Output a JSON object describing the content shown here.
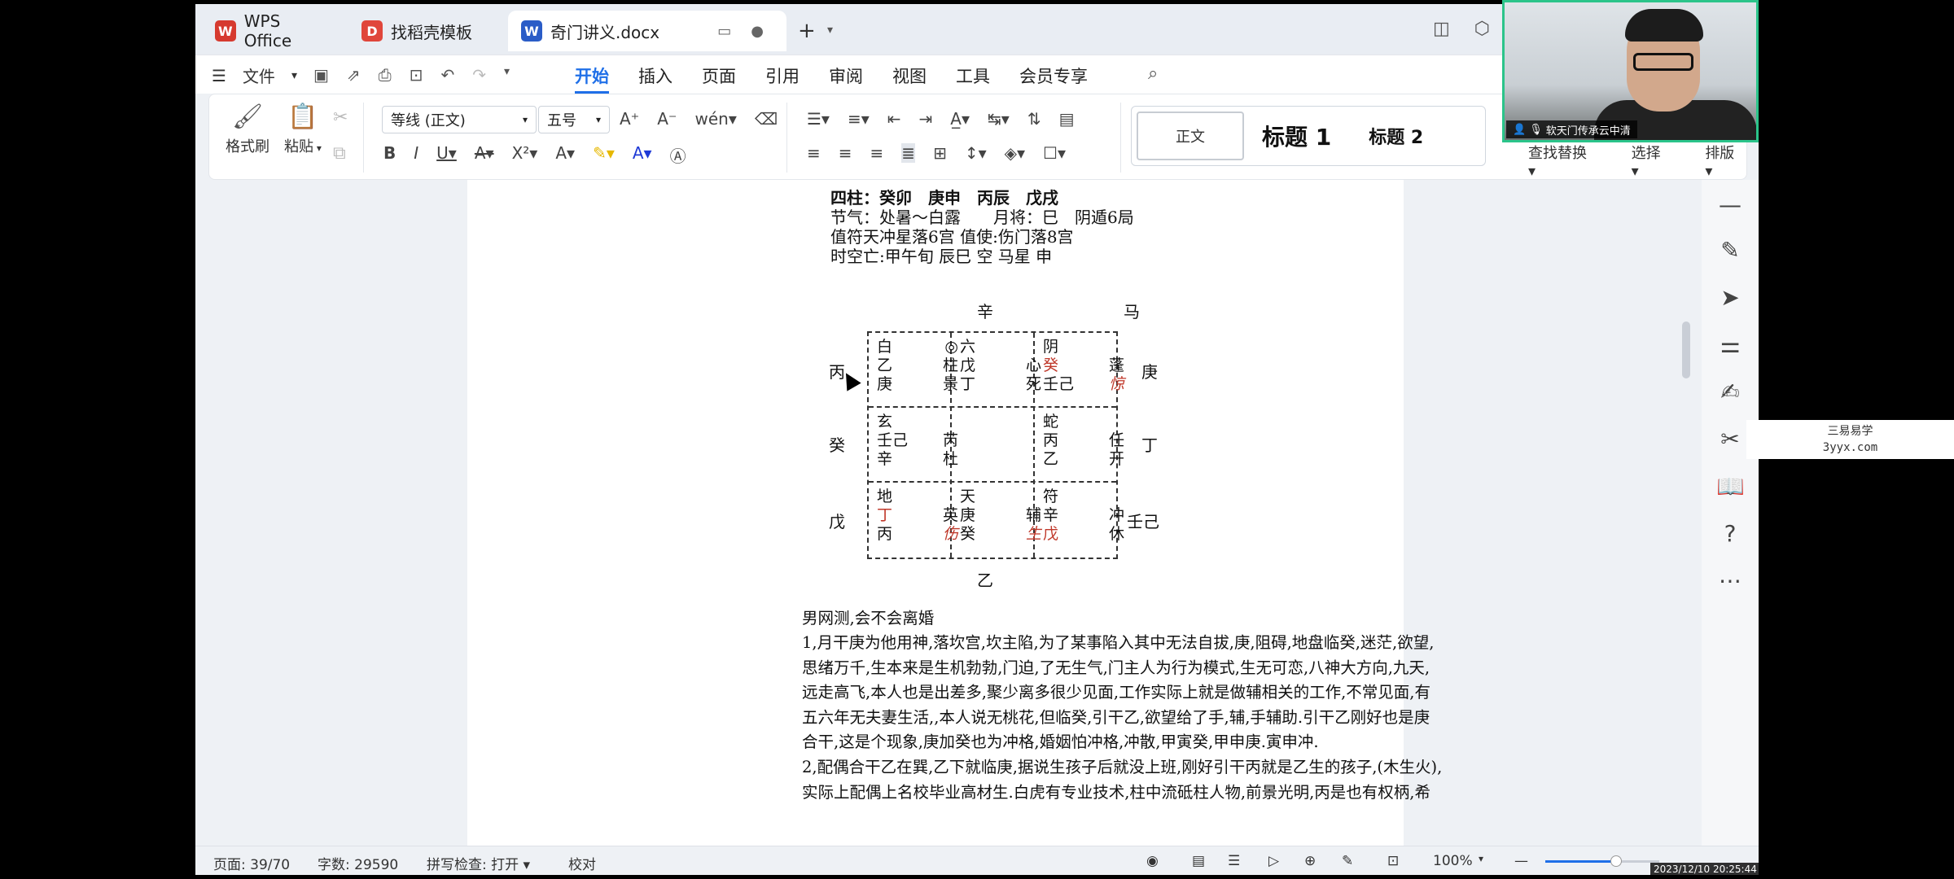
{
  "tabs": [
    {
      "label": "WPS Office",
      "icon": "wps-logo-icon",
      "color": "#d63a2f"
    },
    {
      "label": "找稻壳模板",
      "icon": "docer-icon",
      "color": "#e0463b"
    },
    {
      "label": "奇门讲义.docx",
      "icon": "word-doc-icon",
      "color": "#2a5cc7"
    }
  ],
  "menu": {
    "file": "文件",
    "tabs": [
      "开始",
      "插入",
      "页面",
      "引用",
      "审阅",
      "视图",
      "工具",
      "会员专享"
    ],
    "active_tab": "开始"
  },
  "ribbon": {
    "format_painter": "格式刷",
    "paste": "粘贴",
    "font_name": "等线 (正文)",
    "font_size": "五号",
    "styles": {
      "normal": "正文",
      "h1": "标题 1",
      "h2": "标题 2"
    },
    "find_replace": "查找替换",
    "select": "选择",
    "sort": "排版"
  },
  "doc": {
    "header_lines": [
      "四柱：癸卯　庚申　丙辰　戊戌",
      "节气：处暑～白露　　月将：巳　阴遁6局",
      "值符天冲星落6宫 值使:伤门落8宫",
      "时空亡:甲午旬 辰巳 空 马星 申"
    ],
    "grid_top": "辛",
    "grid_top_right": "马",
    "grid_bottom": "乙",
    "left_labels": [
      "丙",
      "癸",
      "戊"
    ],
    "right_labels": [
      "庚",
      "丁",
      "壬己"
    ],
    "cells": [
      {
        "r1": [
          "白",
          "◎"
        ],
        "r2": [
          "乙",
          "柱"
        ],
        "r3": [
          "庚",
          "景"
        ]
      },
      {
        "r1": [
          "六",
          ""
        ],
        "r2": [
          "戊",
          "心"
        ],
        "r3": [
          "丁",
          "死"
        ]
      },
      {
        "r1": [
          "阴",
          ""
        ],
        "r2": [
          "癸",
          "蓬"
        ],
        "r3": [
          "壬己",
          "惊"
        ]
      },
      {
        "r1": [
          "玄",
          ""
        ],
        "r2": [
          "壬己",
          "芮"
        ],
        "r3": [
          "辛",
          "杜"
        ]
      },
      {
        "r1": [
          "",
          ""
        ],
        "r2": [
          "",
          ""
        ],
        "r3": [
          "",
          ""
        ]
      },
      {
        "r1": [
          "蛇",
          ""
        ],
        "r2": [
          "丙",
          "任"
        ],
        "r3": [
          "乙",
          "开"
        ]
      },
      {
        "r1": [
          "地",
          ""
        ],
        "r2": [
          "丁",
          "英"
        ],
        "r3": [
          "丙",
          "伤"
        ]
      },
      {
        "r1": [
          "天",
          ""
        ],
        "r2": [
          "庚",
          "辅"
        ],
        "r3": [
          "癸",
          "生"
        ]
      },
      {
        "r1": [
          "符",
          ""
        ],
        "r2": [
          "辛",
          "冲"
        ],
        "r3": [
          "戊",
          "休"
        ]
      }
    ],
    "title": "男网测,会不会离婚",
    "para1_lines": [
      "1,月干庚为他用神,落坎宫,坎主陷,为了某事陷入其中无法自拔,庚,阻碍,地盘临癸,迷茫,欲望,",
      "思绪万千,生本来是生机勃勃,门迫,了无生气,门主人为行为模式,生无可恋,八神大方向,九天,",
      "远走高飞,本人也是出差多,聚少离多很少见面,工作实际上就是做辅相关的工作,不常见面,有",
      "五六年无夫妻生活,,本人说无桃花,但临癸,引干乙,欲望给了手,辅,手辅助.引干乙刚好也是庚",
      "合干,这是个现象,庚加癸也为冲格,婚姻怕冲格,冲散,甲寅癸,甲申庚.寅申冲."
    ],
    "para2_lines": [
      "2,配偶合干乙在巽,乙下就临庚,据说生孩子后就没上班,刚好引干丙就是乙生的孩子,(木生火),",
      "实际上配偶上名校毕业高材生.白虎有专业技术,柱中流砥柱人物,前景光明,丙是也有权柄,希"
    ]
  },
  "status": {
    "page": "页面: 39/70",
    "words": "字数: 29590",
    "spell": "拼写检查: 打开",
    "proof": "校对",
    "zoom": "100%",
    "zoom_level": 0.62
  },
  "webcam": {
    "caption": "软天门传承云中清"
  },
  "watermark": {
    "line1": "三易易学",
    "line2": "3yyx.com"
  },
  "timestamp": "2023/12/10 20:25:44"
}
